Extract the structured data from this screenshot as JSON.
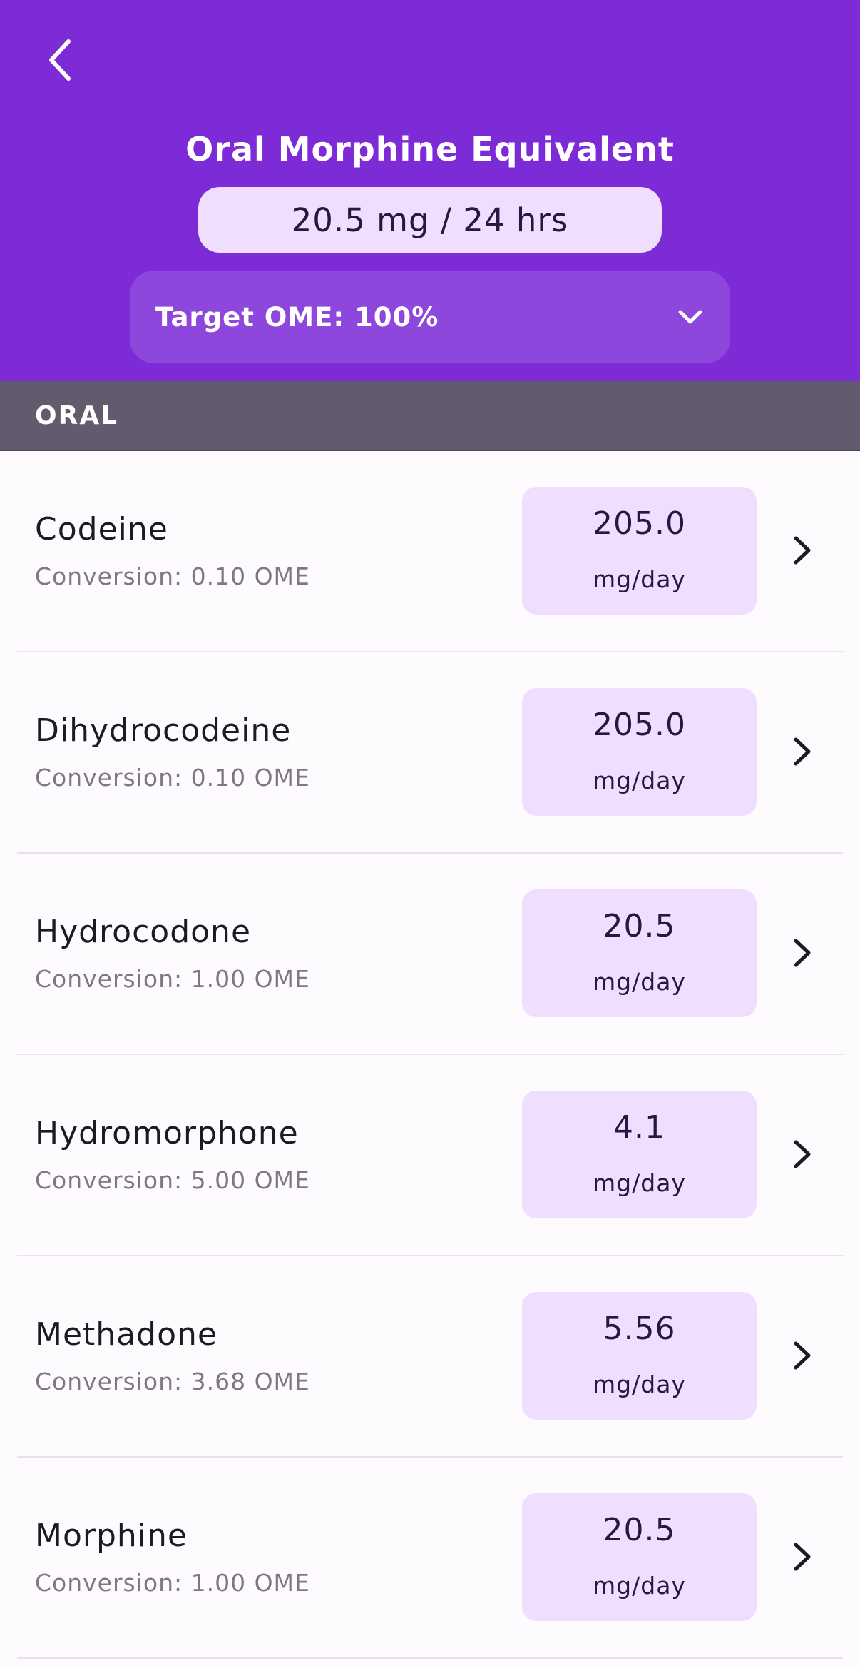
{
  "header": {
    "title": "Oral Morphine Equivalent",
    "ome_value": "20.5 mg / 24 hrs",
    "target_label": "Target OME: 100%",
    "background_color": "#7d2bd7",
    "back_icon": "chevron-left-icon",
    "dropdown_icon": "chevron-down-icon"
  },
  "section": {
    "label": "ORAL"
  },
  "drugs": [
    {
      "name": "Codeine",
      "conversion": "Conversion: 0.10 OME",
      "dose": "205.0",
      "unit": "mg/day"
    },
    {
      "name": "Dihydrocodeine",
      "conversion": "Conversion: 0.10 OME",
      "dose": "205.0",
      "unit": "mg/day"
    },
    {
      "name": "Hydrocodone",
      "conversion": "Conversion: 1.00 OME",
      "dose": "20.5",
      "unit": "mg/day"
    },
    {
      "name": "Hydromorphone",
      "conversion": "Conversion: 5.00 OME",
      "dose": "4.1",
      "unit": "mg/day"
    },
    {
      "name": "Methadone",
      "conversion": "Conversion: 3.68 OME",
      "dose": "5.56",
      "unit": "mg/day"
    },
    {
      "name": "Morphine",
      "conversion": "Conversion: 1.00 OME",
      "dose": "20.5",
      "unit": "mg/day"
    }
  ],
  "colors": {
    "accent": "#7d2bd7",
    "pill": "#efdefe",
    "section_bar": "#645a6d"
  }
}
